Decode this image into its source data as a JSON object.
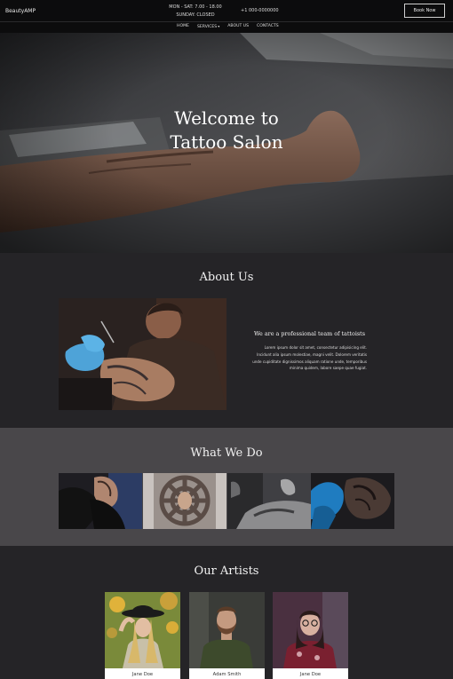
{
  "header": {
    "brand": "BeautyAMP",
    "hours_line1": "MON - SAT: 7.00 - 18.00",
    "hours_line2": "SUNDAY: CLOSED",
    "phone": "+1 000-0000000",
    "book_button": "Book Now"
  },
  "nav": [
    {
      "label": "HOME"
    },
    {
      "label": "SERVICES"
    },
    {
      "label": "ABOUT US"
    },
    {
      "label": "CONTACTS"
    }
  ],
  "hero": {
    "title_line1": "Welcome to",
    "title_line2": "Tattoo Salon"
  },
  "about": {
    "title": "About Us",
    "heading": "We are a professional team of tattoists",
    "body": "Lorem ipsum dolor sit amet, consectetur adipisicing elit. Incidunt alia ipsum molestiae, magni velit. Dolorem veritatis unde cupiditate dignissimos aliquam ratione unde, temporibus minima quidem, labore saepe quae fugiat."
  },
  "services": {
    "title": "What We Do"
  },
  "artists": {
    "title": "Our Artists",
    "list": [
      {
        "name": "Jane Doe"
      },
      {
        "name": "Adam Smith"
      },
      {
        "name": "Jane Doe"
      }
    ]
  },
  "colors": {
    "header_bg": "#0c0c0d",
    "dark_section": "#252427",
    "gray_section": "#49474a"
  }
}
